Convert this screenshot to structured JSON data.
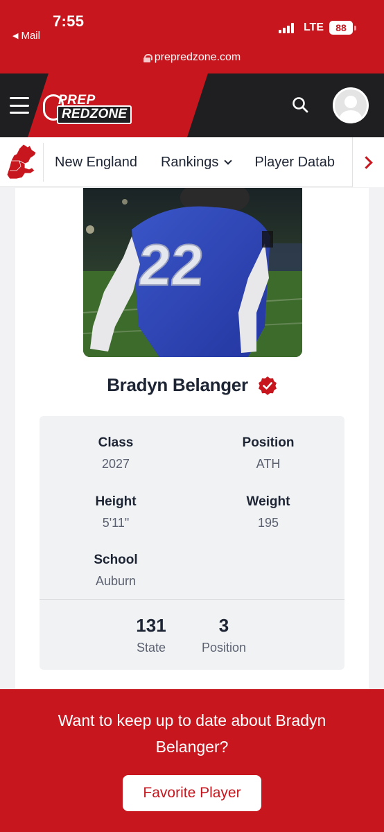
{
  "status_bar": {
    "time": "7:55",
    "back_app": "Mail",
    "network": "LTE",
    "battery": "88"
  },
  "browser": {
    "url": "prepredzone.com"
  },
  "header": {
    "logo_line1": "PREP",
    "logo_line2": "REDZONE",
    "brand_color": "#c8161e"
  },
  "nav": {
    "items": [
      {
        "label": "New England",
        "has_dropdown": false
      },
      {
        "label": "Rankings",
        "has_dropdown": true
      },
      {
        "label": "Player Datab",
        "has_dropdown": false
      }
    ]
  },
  "player": {
    "name": "Bradyn Belanger",
    "jersey_number": "22",
    "stats": {
      "class_label": "Class",
      "class_value": "2027",
      "position_label": "Position",
      "position_value": "ATH",
      "height_label": "Height",
      "height_value": "5'11\"",
      "weight_label": "Weight",
      "weight_value": "195",
      "school_label": "School",
      "school_value": "Auburn"
    },
    "rankings": {
      "state_rank": "131",
      "state_label": "State",
      "position_rank": "3",
      "position_label": "Position"
    }
  },
  "cta": {
    "text": "Want to keep up to date about Bradyn Belanger?",
    "button_label": "Favorite Player"
  }
}
